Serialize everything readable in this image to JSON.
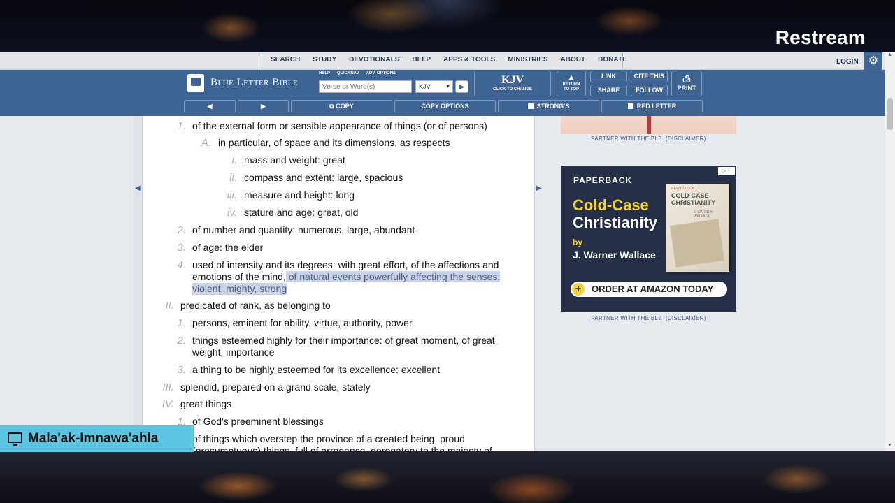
{
  "overlay": {
    "brand": "Restream",
    "name_tag": "Mala'ak-Imnawa'ahla"
  },
  "nav": {
    "links": [
      "SEARCH",
      "STUDY",
      "DEVOTIONALS",
      "HELP",
      "APPS & TOOLS",
      "MINISTRIES",
      "ABOUT",
      "DONATE"
    ],
    "login": "LOGIN"
  },
  "header": {
    "logo_text": "Blue Letter Bible",
    "mini_links": [
      "HELP",
      "QUICKNAV",
      "ADV. OPTIONS"
    ],
    "search_placeholder": "Verse or Word(s)",
    "version_selected": "KJV",
    "kjv_label": "KJV",
    "kjv_sub": "CLICK TO CHANGE",
    "return_top_1": "RETURN",
    "return_top_2": "TO TOP",
    "link": "LINK",
    "share": "SHARE",
    "cite": "CITE THIS",
    "follow": "FOLLOW",
    "print": "PRINT"
  },
  "toolbar": {
    "copy": "COPY",
    "copy_options": "COPY OPTIONS",
    "strongs": "STRONG'S",
    "red_letter": "RED LETTER"
  },
  "definitions": [
    {
      "num": "1.",
      "text": "of the external form or sensible appearance of things (or of persons)"
    },
    {
      "num": "A.",
      "text": "in particular, of space and its dimensions, as respects"
    },
    {
      "num": "i.",
      "text": "mass and weight: great"
    },
    {
      "num": "ii.",
      "text": "compass and extent: large, spacious"
    },
    {
      "num": "iii.",
      "text": "measure and height: long"
    },
    {
      "num": "iv.",
      "text": "stature and age: great, old"
    },
    {
      "num": "2.",
      "text": "of number and quantity: numerous, large, abundant"
    },
    {
      "num": "3.",
      "text": "of age: the elder"
    },
    {
      "num": "4.",
      "text_line1": "used of intensity and its degrees: with great effort, of the affections and",
      "text_line2a": "emotions of the mind,",
      "text_line2b": " of natural events powerfully affecting the senses:",
      "text_line3": "violent, mighty, strong"
    },
    {
      "num": "II.",
      "text": "predicated of rank, as belonging to"
    },
    {
      "num": "1.",
      "text": "persons, eminent for ability, virtue, authority, power"
    },
    {
      "num": "2.",
      "text_line1": "things esteemed highly for their importance: of great moment, of great",
      "text_line2": "weight, importance"
    },
    {
      "num": "3.",
      "text": "a thing to be highly esteemed for its excellence: excellent"
    },
    {
      "num": "III.",
      "text": "splendid, prepared on a grand scale, stately"
    },
    {
      "num": "IV.",
      "text": "great things"
    },
    {
      "num": "1.",
      "text": "of God's preeminent blessings"
    },
    {
      "num": "2.",
      "text_line1": "of things which overstep the province of a created being, proud",
      "text_line2": "(presumptuous) things, full of arrogance, derogatory to the majesty of"
    }
  ],
  "sidebar": {
    "partner": "PARTNER WITH THE BLB",
    "disclaimer": "(DISCLAIMER)",
    "ad": {
      "label": "PAPERBACK",
      "title_1": "Cold-Case",
      "title_2": "Christianity",
      "by": "by",
      "author": "J. Warner Wallace",
      "cta": "ORDER AT AMAZON TODAY",
      "book_sub": "NEW EDITION",
      "book_title_1": "COLD-CASE",
      "book_title_2": "CHRISTIANITY",
      "book_author": "J. WARNER WALLACE"
    }
  },
  "colors": {
    "header_blue": "#3e6494",
    "highlight": "#c9d3e5",
    "name_tag": "#5bc4e0",
    "ad_bg": "#262f48",
    "ad_yellow": "#f4d23a"
  }
}
